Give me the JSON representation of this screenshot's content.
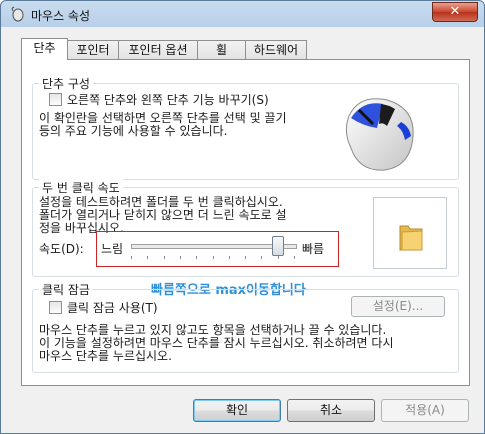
{
  "window": {
    "title": "마우스 속성",
    "close_label": "✕"
  },
  "tabs": [
    {
      "label": "단추",
      "active": true
    },
    {
      "label": "포인터",
      "active": false
    },
    {
      "label": "포인터 옵션",
      "active": false
    },
    {
      "label": "휠",
      "active": false
    },
    {
      "label": "하드웨어",
      "active": false
    }
  ],
  "button_config": {
    "title": "단추 구성",
    "checkbox_label": "오른쪽 단추와 왼쪽 단추 기능 바꾸기(S)",
    "checked": false,
    "description_line1": "이 확인란을 선택하면 오른쪽 단추를 선택 및 끌기",
    "description_line2": "등의 주요 기능에 사용할 수 있습니다."
  },
  "double_click": {
    "title": "두 번 클릭 속도",
    "description_line1": "설정을 테스트하려면 폴더를 두 번 클릭하십시오.",
    "description_line2": "폴더가 열리거나 닫히지 않으면 더 느린 속도로 설",
    "description_line3": "정을 바꾸십시오.",
    "speed_label": "속도(D):",
    "slow_label": "느림",
    "fast_label": "빠름",
    "speed_value": 0.93
  },
  "annotation": "빠름쪽으로 max이동합니다",
  "click_lock": {
    "title": "클릭 잠금",
    "checkbox_label": "클릭 잠금 사용(T)",
    "checked": false,
    "settings_button": "설정(E)...",
    "description_line1": "마우스 단추를 누르고 있지 않고도 항목을 선택하거나 끌 수 있습니다.",
    "description_line2": "이 기능을 설정하려면 마우스 단추를 잠시 누르십시오. 취소하려면 다시",
    "description_line3": "마우스 단추를 누르십시오."
  },
  "footer": {
    "ok": "확인",
    "cancel": "취소",
    "apply": "적용(A)"
  },
  "colors": {
    "annotation": "#2f8fd9",
    "highlight_border": "#d02424"
  }
}
